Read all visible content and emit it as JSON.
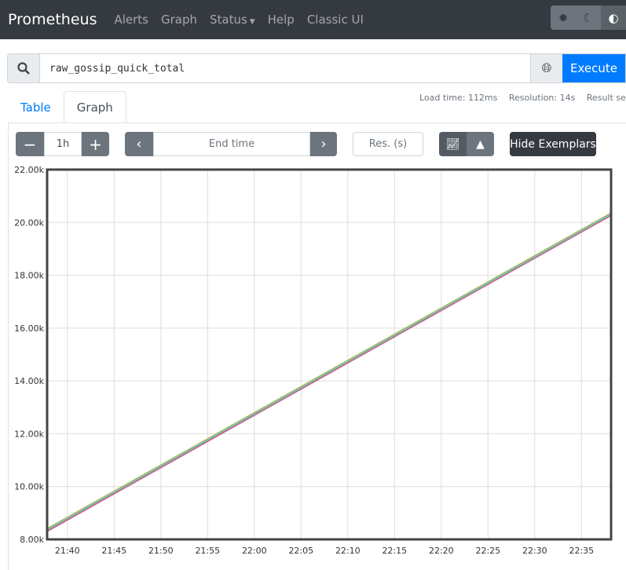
{
  "navbar": {
    "brand": "Prometheus",
    "links": [
      "Alerts",
      "Graph",
      "Status",
      "Help",
      "Classic UI"
    ],
    "theme_icons": [
      "sun-icon",
      "moon-icon",
      "contrast-icon"
    ]
  },
  "query": {
    "value": "raw_gossip_quick_total",
    "execute_label": "Execute"
  },
  "stats": {
    "load_time": "Load time: 112ms",
    "resolution": "Resolution: 14s",
    "result_series": "Result series: "
  },
  "tabs": [
    {
      "label": "Table",
      "active": false
    },
    {
      "label": "Graph",
      "active": true
    }
  ],
  "controls": {
    "range": "1h",
    "end_time_placeholder": "End time",
    "resolution_placeholder": "Res. (s)",
    "hide_exemplars": "Hide Exemplars",
    "chart_mode": "lines"
  },
  "chart_data": {
    "type": "line",
    "yticks": [
      "8.00k",
      "10.00k",
      "12.00k",
      "14.00k",
      "16.00k",
      "18.00k",
      "20.00k",
      "22.00k"
    ],
    "ylim": [
      8000,
      22000
    ],
    "xticks": [
      "21:40",
      "21:45",
      "21:50",
      "21:55",
      "22:00",
      "22:05",
      "22:10",
      "22:15",
      "22:20",
      "22:25",
      "22:30",
      "22:35"
    ],
    "xlim": [
      "21:37:50",
      "22:38:10"
    ],
    "grid": true,
    "series": [
      {
        "color": "#b8b842",
        "x": [
          "21:37:50",
          "22:38:10"
        ],
        "values": [
          8400,
          20350
        ]
      },
      {
        "color": "#a05ed6",
        "x": [
          "21:37:50",
          "22:38:10"
        ],
        "values": [
          8330,
          20280
        ]
      },
      {
        "color": "#d65e8c",
        "x": [
          "21:37:50",
          "22:38:10"
        ],
        "values": [
          8310,
          20270
        ]
      },
      {
        "color": "#5ea0d6",
        "x": [
          "21:37:50",
          "22:38:10"
        ],
        "values": [
          8360,
          20310
        ]
      },
      {
        "color": "#8cc08c",
        "x": [
          "21:37:50",
          "22:38:10"
        ],
        "values": [
          8380,
          20330
        ]
      }
    ]
  }
}
